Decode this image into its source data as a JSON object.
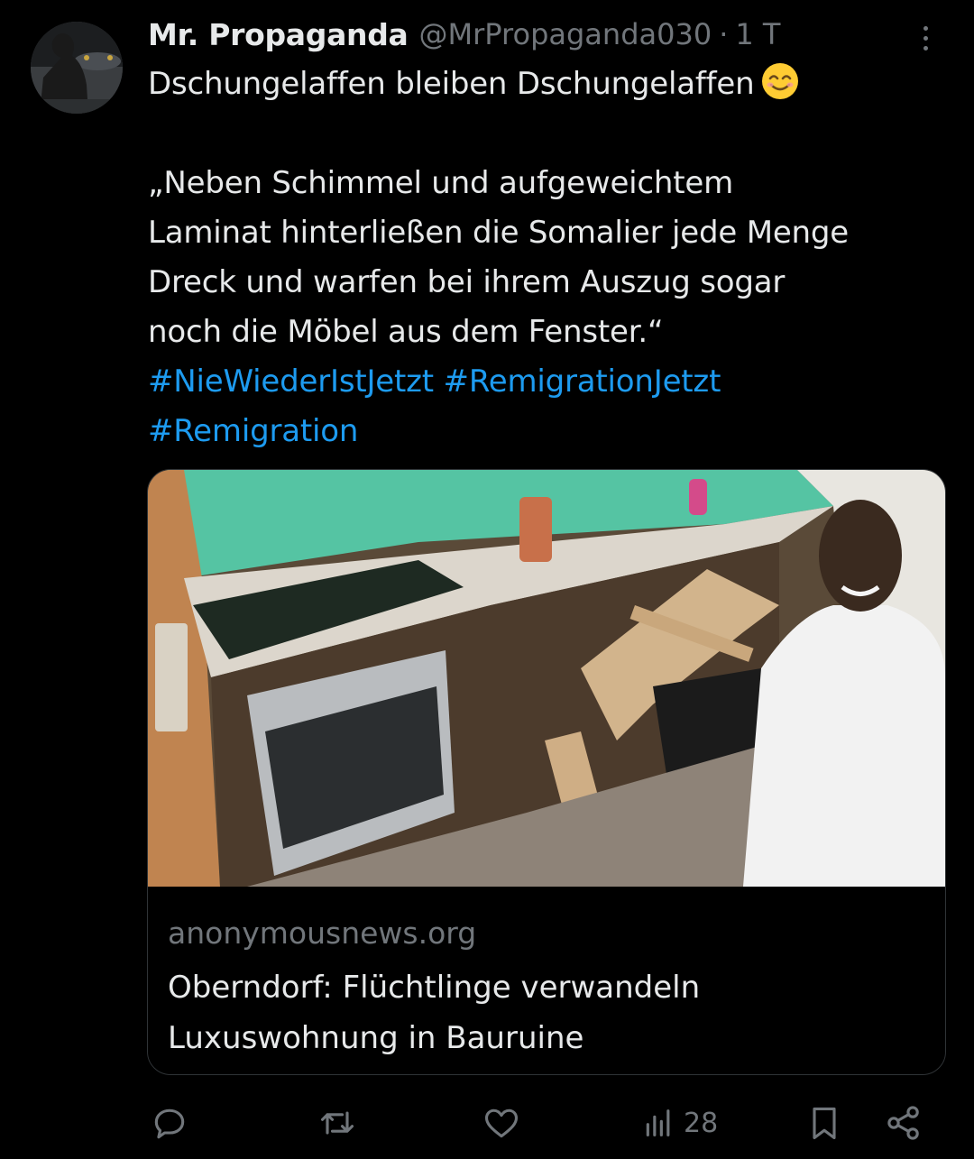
{
  "tweet": {
    "author_name": "Mr. Propaganda",
    "handle": "@MrPropaganda030",
    "separator": "·",
    "time": "1 T",
    "lines": [
      "Dschungelaffen bleiben Dschungelaffen",
      "„Neben Schimmel und aufgeweichtem",
      "Laminat hinterließen die Somalier jede Menge",
      "Dreck und warfen bei ihrem Auszug sogar",
      "noch die Möbel aus dem Fenster.“"
    ],
    "hashtags": [
      "#NieWiederIstJetzt",
      "#RemigrationJetzt",
      "#Remigration"
    ],
    "emoji": "smiling-face-emoji"
  },
  "card": {
    "domain": "anonymousnews.org",
    "title_lines": [
      "Oberndorf: Flüchtlinge verwandeln",
      "Luxuswohnung in Bauruine"
    ]
  },
  "actions": {
    "views_count": "28"
  },
  "colors": {
    "background": "#000000",
    "text": "#e7e9ea",
    "muted": "#71767b",
    "link": "#1d9bf0",
    "border": "#2f3336"
  }
}
